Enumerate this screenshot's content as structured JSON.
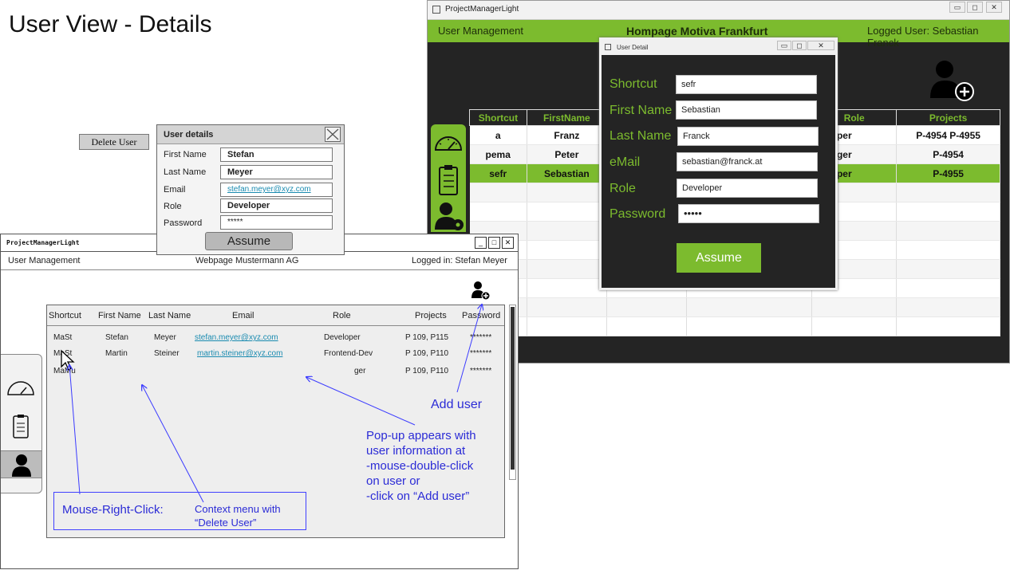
{
  "slide": {
    "title": "User View - Details"
  },
  "app_window": {
    "title": "ProjectManagerLight",
    "window_buttons": {
      "minimize": "▭",
      "restore": "◻",
      "close": "✕"
    },
    "header": {
      "left": "User Management",
      "center": "Hompage Motiva Frankfurt",
      "right": "Logged User: Sebastian Franck"
    },
    "add_user_icon": "add-user-icon",
    "table": {
      "headers": [
        "Shortcut",
        "FirstName",
        "Role",
        "Projects"
      ],
      "rows": [
        {
          "shortcut": "a",
          "first": "Franz",
          "role": "eveloper",
          "projects": "P-4954 P-4955"
        },
        {
          "shortcut": "pema",
          "first": "Peter",
          "role": "Manager",
          "projects": "P-4954"
        },
        {
          "shortcut": "sefr",
          "first": "Sebastian",
          "role": "eveloper",
          "projects": "P-4955"
        }
      ],
      "selected_row": 2
    },
    "dialog": {
      "title": "User Detail",
      "fields": [
        {
          "label": "Shortcut",
          "value": "sefr"
        },
        {
          "label": "First Name",
          "value": "Sebastian"
        },
        {
          "label": "Last Name",
          "value": "Franck"
        },
        {
          "label": "eMail",
          "value": "sebastian@franck.at"
        },
        {
          "label": "Role",
          "value": "Developer"
        },
        {
          "label": "Password",
          "value": "•••••"
        }
      ],
      "button": "Assume"
    },
    "colors": {
      "accent": "#7cbb2e",
      "background": "#242424"
    }
  },
  "mockup_window": {
    "title": "ProjectManagerLight",
    "window_buttons": {
      "minimize": "_",
      "restore": "□",
      "close": "✕"
    },
    "menubar": {
      "left": "User Management",
      "center": "Webpage Mustermann AG",
      "right": "Logged in: Stefan Meyer"
    },
    "table": {
      "headers": [
        "Shortcut",
        "First Name",
        "Last Name",
        "Email",
        "Role",
        "Projects",
        "Password"
      ],
      "rows": [
        {
          "shortcut": "MaSt",
          "first": "Stefan",
          "last": "Meyer",
          "email": "stefan.meyer@xyz.com",
          "role": "Developer",
          "projects": "P 109, P115",
          "password": "*******"
        },
        {
          "shortcut": "MaSt",
          "first": "Martin",
          "last": "Steiner",
          "email": "martin.steiner@xyz.com",
          "role": "Frontend-Dev",
          "projects": "P 109, P110",
          "password": "*******"
        },
        {
          "shortcut": "MaMu",
          "first": "",
          "last": "",
          "email": "",
          "role": "ger",
          "projects": "P 109, P110",
          "password": "*******"
        }
      ]
    },
    "context_menu": {
      "item": "Delete User"
    },
    "dialog": {
      "title": "User details",
      "fields": [
        {
          "label": "First Name",
          "value": "Stefan"
        },
        {
          "label": "Last Name",
          "value": "Meyer"
        },
        {
          "label": "Email",
          "value": "stefan.meyer@xyz.com"
        },
        {
          "label": "Role",
          "value": "Developer"
        },
        {
          "label": "Password",
          "value": "*****"
        }
      ],
      "button": "Assume"
    }
  },
  "annotations": {
    "add_user": "Add user",
    "popup": [
      "Pop-up appears with",
      "user information at",
      "-mouse-double-click",
      "on user or",
      "-click on “Add user”"
    ],
    "right_click": "Mouse-Right-Click:",
    "context_menu": [
      "Context menu with",
      "“Delete User”"
    ],
    "color": "#2b2bd6"
  }
}
